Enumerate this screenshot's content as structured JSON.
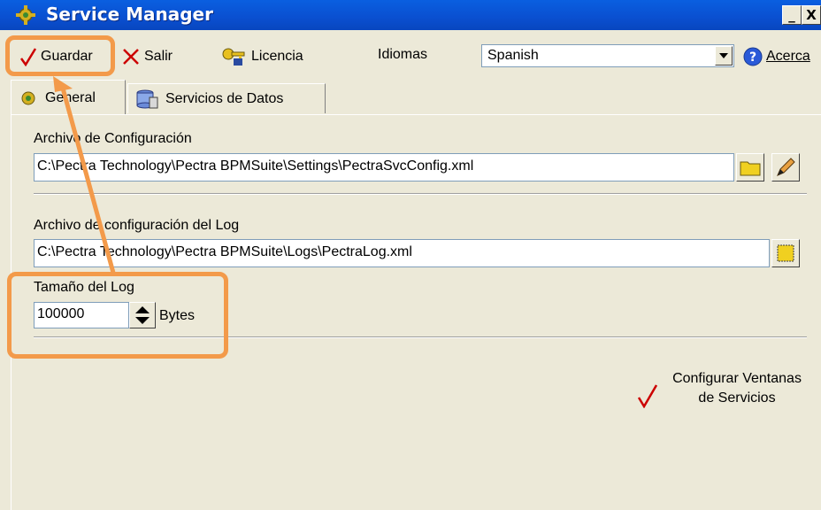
{
  "window": {
    "title": "Service Manager",
    "minimize_label": "_",
    "close_label": "X"
  },
  "toolbar": {
    "save_label": "Guardar",
    "exit_label": "Salir",
    "license_label": "Licencia",
    "languages_label": "Idiomas",
    "language_value": "Spanish",
    "about_label": "Acerca"
  },
  "tabs": [
    {
      "label": "General",
      "icon": "gear-icon"
    },
    {
      "label": "Servicios de Datos",
      "icon": "database-icon"
    }
  ],
  "general": {
    "config_file_label": "Archivo de Configuración",
    "config_file_value": "C:\\Pectra Technology\\Pectra BPMSuite\\Settings\\PectraSvcConfig.xml",
    "log_config_label": "Archivo de configuración del Log",
    "log_config_value": "C:\\Pectra Technology\\Pectra BPMSuite\\Logs\\PectraLog.xml",
    "log_size_label": "Tamaño del Log",
    "log_size_value": "100000",
    "log_size_unit": "Bytes",
    "configure_windows_label_line1": "Configurar Ventanas",
    "configure_windows_label_line2": "de Servicios"
  },
  "colors": {
    "titlebar": "#0a5fe0",
    "highlight": "#f39a4a",
    "window_bg": "#ece9d8",
    "check": "#cc0000"
  }
}
